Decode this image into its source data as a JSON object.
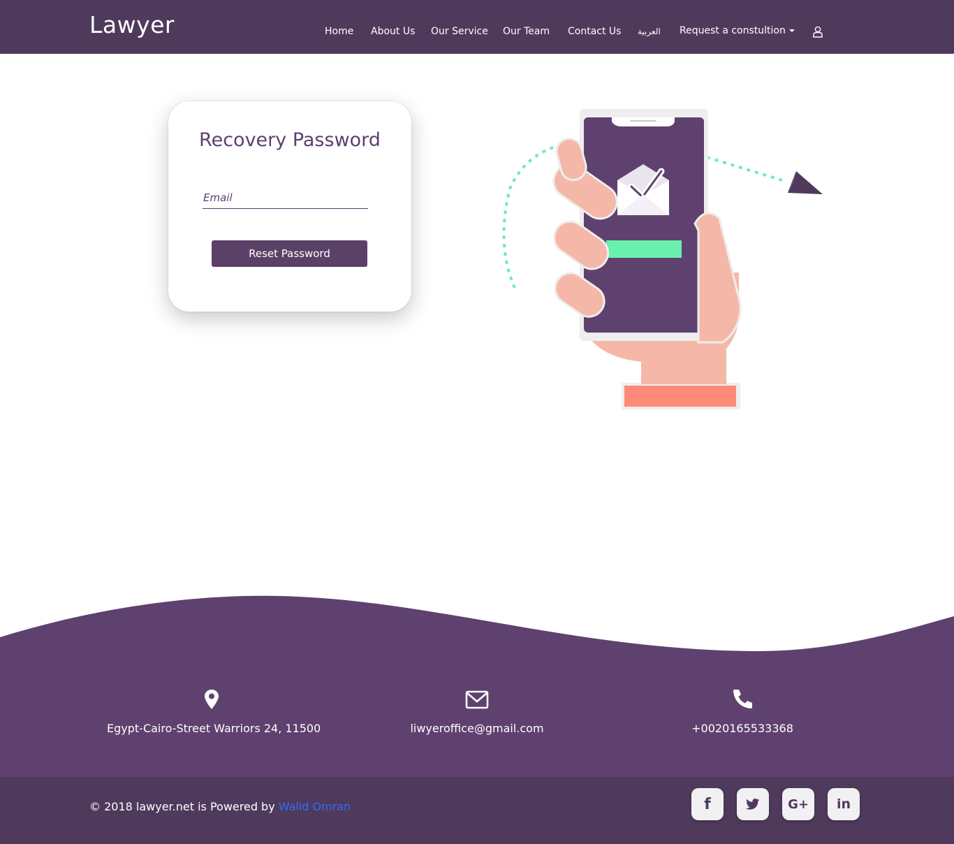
{
  "navbar": {
    "brand": "Lawyer",
    "items": [
      {
        "label": "Home"
      },
      {
        "label": "About Us"
      },
      {
        "label": "Our Service"
      },
      {
        "label": "Our Team"
      },
      {
        "label": "Contact Us"
      },
      {
        "label": "العربية"
      },
      {
        "label": "Request a constultion"
      }
    ],
    "user_icon": "user-icon"
  },
  "card": {
    "title": "Recovery Password",
    "email_placeholder": "Email",
    "button_label": "Reset Password"
  },
  "footer": {
    "contacts": [
      {
        "icon": "map-marker-icon",
        "text": "Egypt-Cairo-Street Warriors 24, 11500"
      },
      {
        "icon": "envelope-icon",
        "text": "liwyeroffice@gmail.com"
      },
      {
        "icon": "phone-icon",
        "text": "+0020165533368"
      }
    ],
    "copyright_prefix": "© 2018 lawyer.net is Powered by ",
    "author": "Walid Omran",
    "social": [
      {
        "icon": "facebook-icon",
        "glyph": "f"
      },
      {
        "icon": "twitter-icon",
        "glyph": "🐦"
      },
      {
        "icon": "google-plus-icon",
        "glyph": "G+"
      },
      {
        "icon": "linkedin-icon",
        "glyph": "in"
      }
    ]
  },
  "colors": {
    "primary": "#5e3f6f",
    "navbar": "#4f3a5c",
    "footer_wave": "#5f416f",
    "accent_green": "#69f0ae",
    "skin": "#f5b8a8",
    "sleeve": "#ff8a7a",
    "link": "#2f6bff"
  }
}
